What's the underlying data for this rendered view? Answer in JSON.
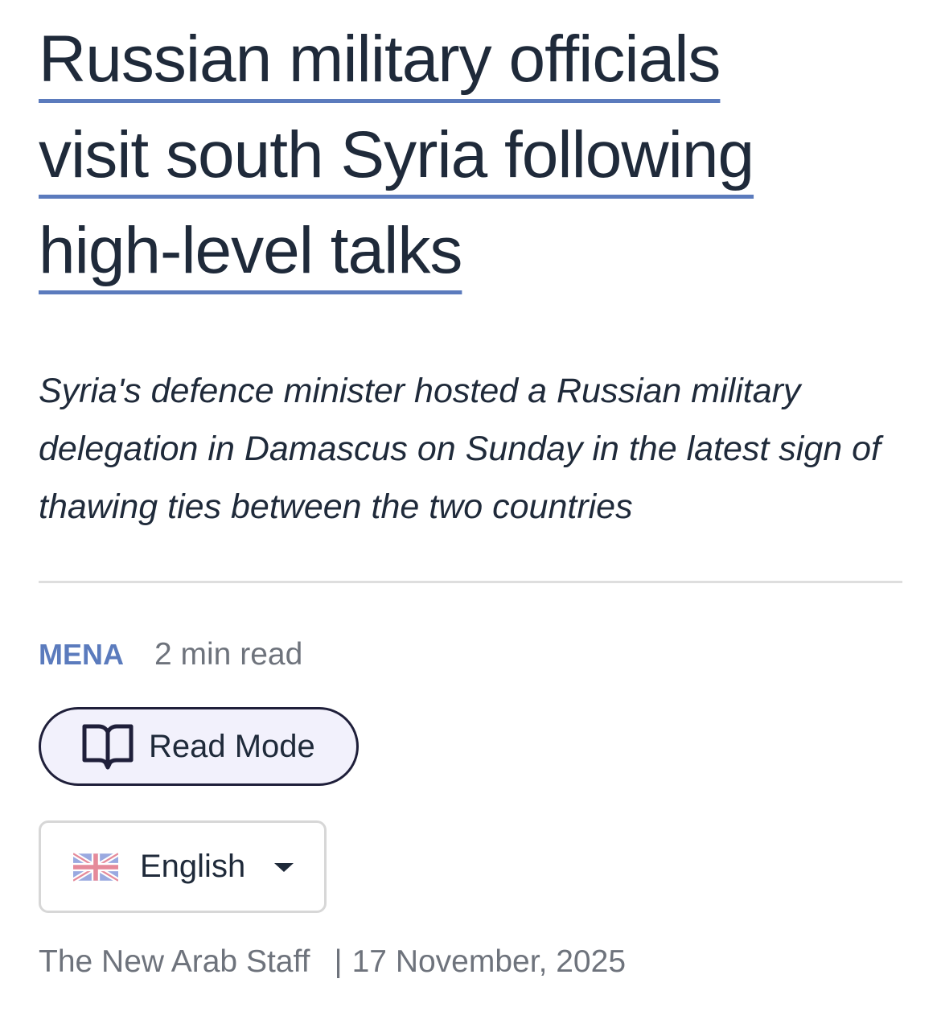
{
  "article": {
    "headline_lines": [
      "Russian military officials",
      "visit south Syria following",
      "high-level talks"
    ],
    "standfirst": "Syria's defence minister hosted a Russian military delegation in Damascus on Sunday in the latest sign of thawing ties between the two countries",
    "section": "MENA",
    "read_time": "2 min read",
    "author": "The New Arab Staff",
    "separator": "|",
    "date": "17 November, 2025"
  },
  "controls": {
    "read_mode_label": "Read Mode",
    "read_mode_icon": "open-book-icon",
    "language": {
      "selected": "English",
      "flag_icon": "uk-flag-icon",
      "dropdown_icon": "caret-down-icon"
    }
  },
  "colors": {
    "accent": "#5b7bbd",
    "text": "#1f2a3a",
    "muted": "#6e737c",
    "read_mode_bg": "#f2f1fc",
    "divider": "#dedede"
  }
}
